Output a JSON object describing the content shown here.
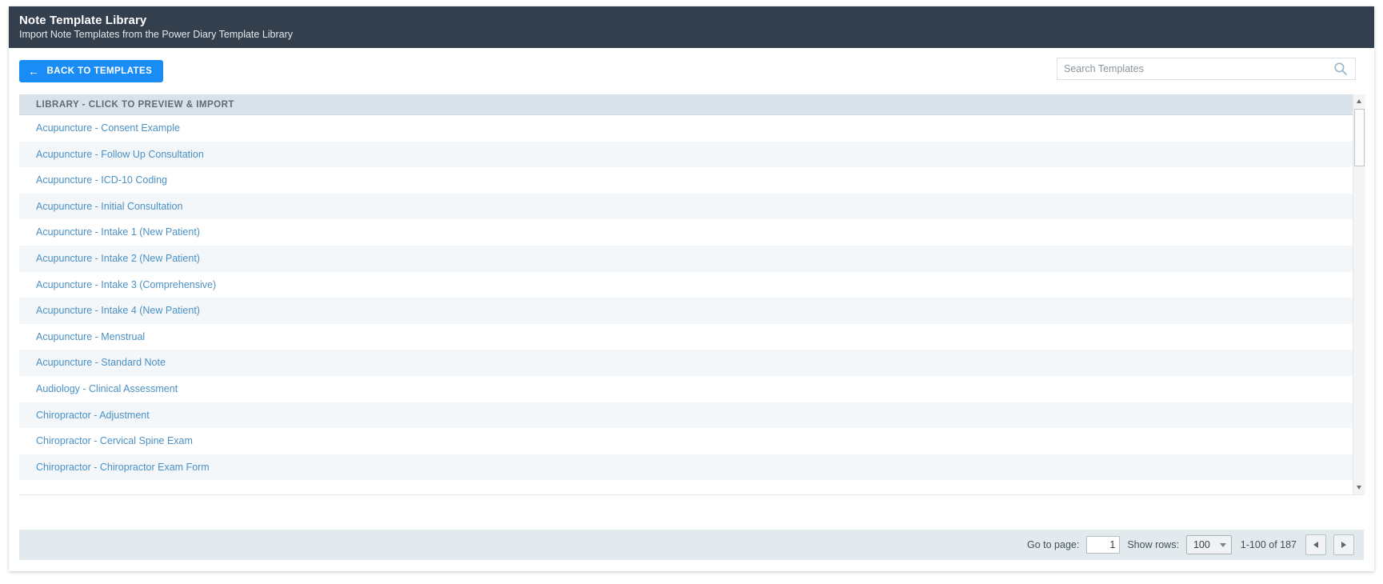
{
  "header": {
    "title": "Note Template Library",
    "subtitle": "Import Note Templates from the Power Diary Template Library"
  },
  "toolbar": {
    "back_label": "BACK TO TEMPLATES",
    "back_arrow": "←",
    "back_button_color": "#1a8cf5"
  },
  "search": {
    "placeholder": "Search Templates",
    "value": "",
    "icon": "search-icon"
  },
  "table": {
    "header_label": "LIBRARY - CLICK TO PREVIEW & IMPORT",
    "rows": [
      "Acupuncture - Consent Example",
      "Acupuncture - Follow Up Consultation",
      "Acupuncture - ICD-10 Coding",
      "Acupuncture - Initial Consultation",
      "Acupuncture - Intake 1 (New Patient)",
      "Acupuncture - Intake 2 (New Patient)",
      "Acupuncture - Intake 3 (Comprehensive)",
      "Acupuncture - Intake 4 (New Patient)",
      "Acupuncture - Menstrual",
      "Acupuncture - Standard Note",
      "Audiology - Clinical Assessment",
      "Chiropractor - Adjustment",
      "Chiropractor - Cervical Spine Exam",
      "Chiropractor - Chiropractor Exam Form"
    ],
    "link_color": "#4a90c4"
  },
  "footer": {
    "goto_label": "Go to page:",
    "page_value": "1",
    "show_rows_label": "Show rows:",
    "rows_per_page": "100",
    "range_text": "1-100 of 187",
    "prev_label": "◀",
    "next_label": "▶"
  }
}
